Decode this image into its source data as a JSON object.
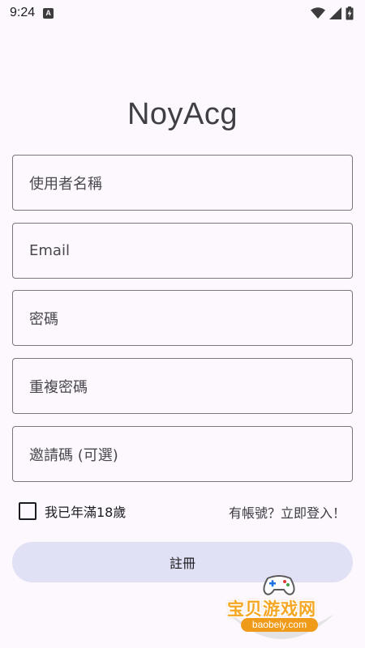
{
  "status_bar": {
    "time": "9:24",
    "notification_letter": "A"
  },
  "app": {
    "title": "NoyAcg"
  },
  "form": {
    "username_placeholder": "使用者名稱",
    "email_placeholder": "Email",
    "password_placeholder": "密碼",
    "repeat_password_placeholder": "重複密碼",
    "invite_code_placeholder": "邀請碼 (可選)",
    "age_checkbox_label": "我已年滿18歲",
    "age_checked": false,
    "login_link": "有帳號？立即登入！",
    "register_button": "註冊"
  },
  "watermark": {
    "text": "宝贝游戏网",
    "url": "baobeiy.com"
  },
  "colors": {
    "background": "#fcf8fd",
    "field_border": "#7a7680",
    "button_bg": "#e1e1f6",
    "watermark_orange": "#f5a623"
  },
  "icons": [
    "wifi-icon",
    "signal-icon",
    "battery-charging-icon",
    "gamepad-icon"
  ]
}
